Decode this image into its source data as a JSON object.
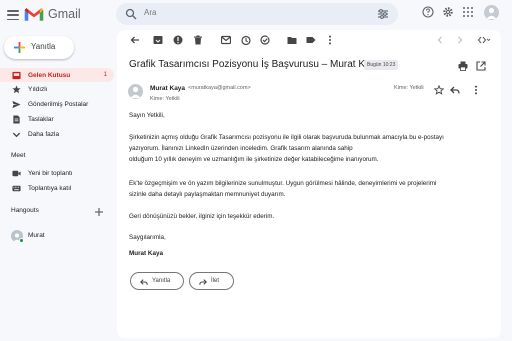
{
  "app": {
    "name": "Gmail"
  },
  "search": {
    "placeholder": "Ara"
  },
  "compose": {
    "label": "Yanıtla"
  },
  "sidebar": {
    "items": [
      {
        "label": "Gelen Kutusu",
        "count": "1",
        "icon": "inbox-icon",
        "active": true
      },
      {
        "label": "Yıldızlı",
        "icon": "star-icon"
      },
      {
        "label": "Gönderilmiş Postalar",
        "icon": "send-icon"
      },
      {
        "label": "Taslaklar",
        "icon": "draft-icon"
      },
      {
        "label": "Daha fazla",
        "icon": "chevron-down-icon"
      }
    ],
    "meet": {
      "title": "Meet",
      "items": [
        {
          "label": "Yeni bir toplantı",
          "icon": "video-icon"
        },
        {
          "label": "Toplantıya katıl",
          "icon": "keyboard-icon"
        }
      ]
    },
    "hangouts": {
      "title": "Hangouts",
      "user": "Murat"
    }
  },
  "email": {
    "subject": "Grafik Tasarımcısı Pozisyonu İş Başvurusu – Murat Kaya",
    "badge": "Bugün 10:23",
    "sender_name": "Murat Kaya",
    "sender_email": "<muratkaya@gmail.com>",
    "recipient": "Kime: Yetkili",
    "meta": "Kime: Yetkili",
    "body": [
      "Sayın Yetkili,",
      "Şirketinizin açmış olduğu Grafik Tasarımcısı pozisyonu ile ilgili olarak başvuruda bulunmak amacıyla bu e-postayı",
      "yazıyorum. İlanınızı LinkedIn üzerinden inceledim. Grafik tasarım alanında sahip",
      "olduğum 10 yıllık deneyim ve uzmanlığım ile şirketinize değer katabileceğime inanıyorum.",
      "Ek'te özgeçmişim ve ön yazım bilgilerinize sunulmuştur. Uygun görülmesi hâlinde, deneyimlerimi ve projelerimi",
      "sizinle daha detaylı paylaşmaktan memnuniyet duyarım.",
      "Geri dönüşünüzü bekler, ilginiz için teşekkür ederim.",
      "Saygılarımla,",
      "Murat Kaya"
    ]
  },
  "actions": {
    "reply": "Yanıtla",
    "forward": "İlet"
  },
  "colors": {
    "accent_red": "#c5221f",
    "compose_bg": "#ffffff",
    "page_bg": "#f6f8fc"
  }
}
